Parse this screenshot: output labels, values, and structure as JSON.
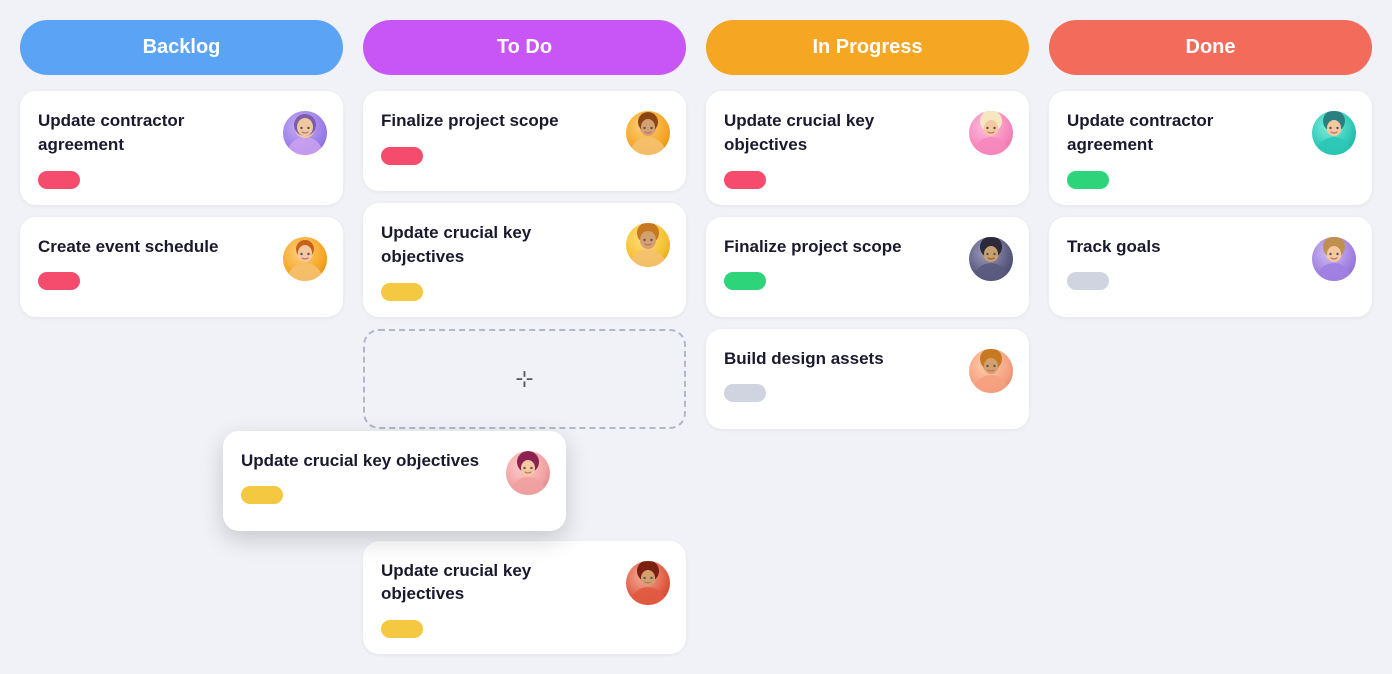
{
  "columns": [
    {
      "id": "backlog",
      "header": "Backlog",
      "headerClass": "header-backlog",
      "cards": [
        {
          "id": "backlog-1",
          "title": "Update contractor agreement",
          "tag": "red",
          "avatarClass": "av-purple",
          "avatarEmoji": "👩"
        },
        {
          "id": "backlog-2",
          "title": "Create event schedule",
          "tag": "red",
          "avatarClass": "av-orange",
          "avatarEmoji": "👩"
        }
      ]
    },
    {
      "id": "todo",
      "header": "To Do",
      "headerClass": "header-todo",
      "cards": [
        {
          "id": "todo-1",
          "title": "Finalize project scope",
          "tag": "red",
          "avatarClass": "av-orange",
          "avatarEmoji": "👨"
        },
        {
          "id": "todo-2",
          "title": "Update crucial key objectives",
          "tag": "yellow",
          "avatarClass": "av-yellow-curly",
          "avatarEmoji": "👩"
        },
        {
          "id": "todo-placeholder",
          "placeholder": true
        },
        {
          "id": "todo-3",
          "title": "Update crucial key objectives",
          "tag": "yellow",
          "avatarClass": "av-red",
          "avatarEmoji": "👨"
        }
      ],
      "draggingCard": {
        "title": "Update crucial key objectives",
        "tag": "yellow",
        "avatarClass": "av-pale",
        "avatarEmoji": "👩"
      }
    },
    {
      "id": "inprogress",
      "header": "In Progress",
      "headerClass": "header-inprogress",
      "cards": [
        {
          "id": "ip-1",
          "title": "Update crucial key objectives",
          "tag": "red",
          "avatarClass": "av-pink",
          "avatarEmoji": "👩"
        },
        {
          "id": "ip-2",
          "title": "Finalize project scope",
          "tag": "green",
          "avatarClass": "av-dark",
          "avatarEmoji": "👨"
        },
        {
          "id": "ip-3",
          "title": "Build design assets",
          "tag": "gray",
          "avatarClass": "av-peach",
          "avatarEmoji": "👨"
        }
      ]
    },
    {
      "id": "done",
      "header": "Done",
      "headerClass": "header-done",
      "cards": [
        {
          "id": "done-1",
          "title": "Update contractor agreement",
          "tag": "green",
          "avatarClass": "av-teal",
          "avatarEmoji": "👩"
        },
        {
          "id": "done-2",
          "title": "Track goals",
          "tag": "gray",
          "avatarClass": "av-lavender",
          "avatarEmoji": "👩"
        }
      ]
    }
  ]
}
